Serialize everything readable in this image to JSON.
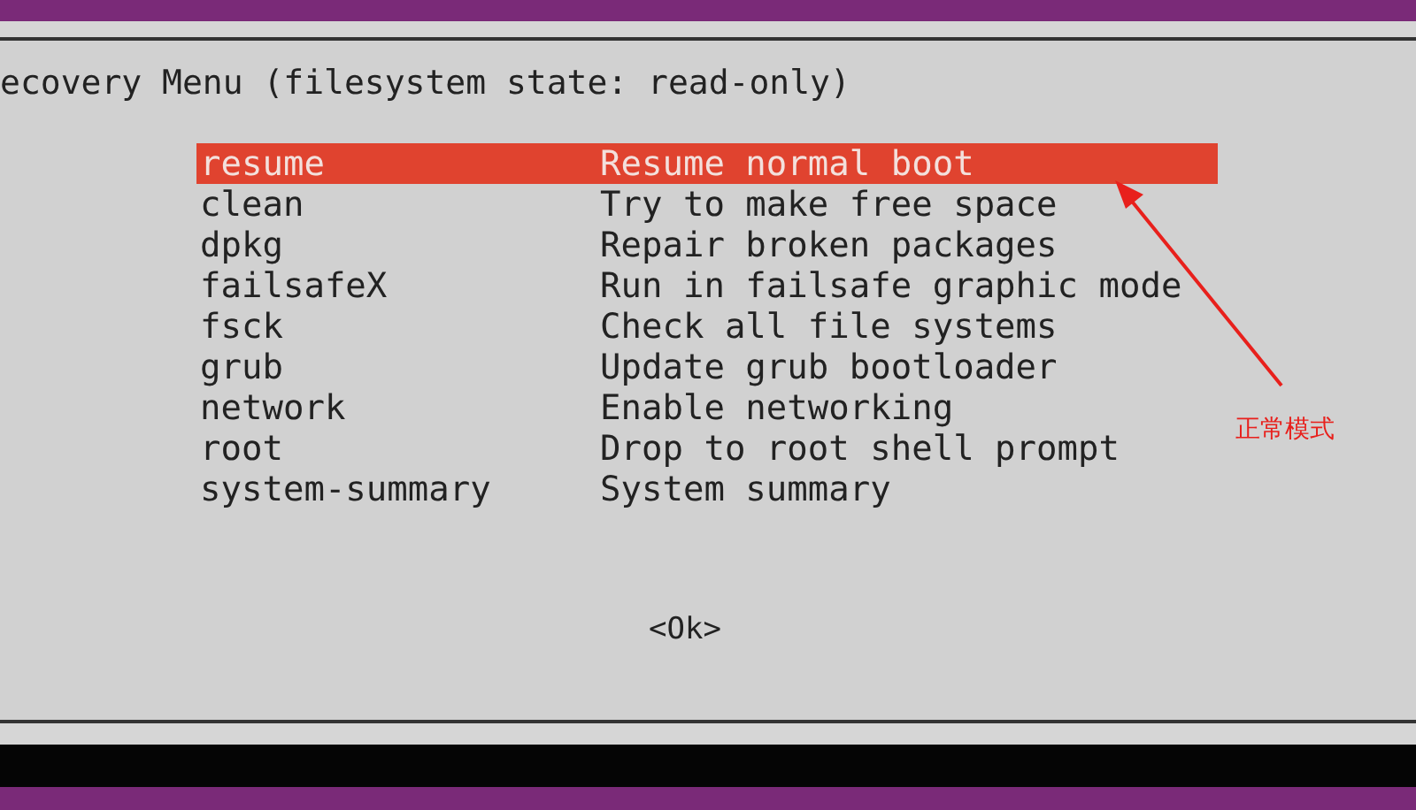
{
  "dialog": {
    "title": "ecovery Menu (filesystem state: read-only)",
    "items": [
      {
        "name": "resume",
        "description": "Resume normal boot",
        "selected": true
      },
      {
        "name": "clean",
        "description": "Try to make free space",
        "selected": false
      },
      {
        "name": "dpkg",
        "description": "Repair broken packages",
        "selected": false
      },
      {
        "name": "failsafeX",
        "description": "Run in failsafe graphic mode",
        "selected": false
      },
      {
        "name": "fsck",
        "description": "Check all file systems",
        "selected": false
      },
      {
        "name": "grub",
        "description": "Update grub bootloader",
        "selected": false
      },
      {
        "name": "network",
        "description": "Enable networking",
        "selected": false
      },
      {
        "name": "root",
        "description": "Drop to root shell prompt",
        "selected": false
      },
      {
        "name": "system-summary",
        "description": "System summary",
        "selected": false
      }
    ],
    "button": "<Ok>"
  },
  "annotation": {
    "label": "正常模式"
  }
}
